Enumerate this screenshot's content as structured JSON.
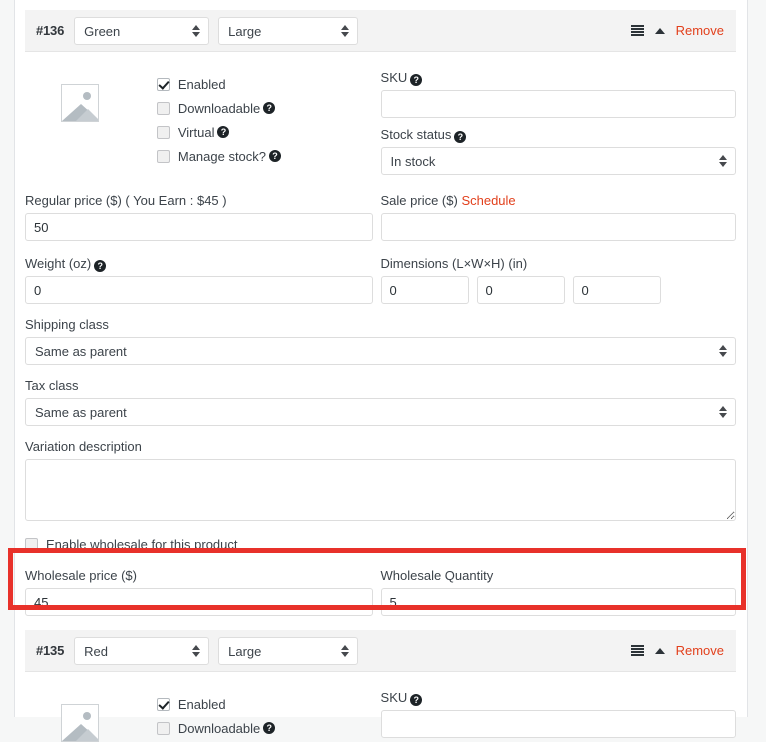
{
  "variations": [
    {
      "id": "#136",
      "attribute_color": "Green",
      "attribute_size": "Large",
      "remove_label": "Remove",
      "checkboxes": [
        {
          "label": "Enabled",
          "checked": true,
          "help": false
        },
        {
          "label": "Downloadable",
          "checked": false,
          "help": true
        },
        {
          "label": "Virtual",
          "checked": false,
          "help": true
        },
        {
          "label": "Manage stock?",
          "checked": false,
          "help": true
        }
      ],
      "sku_label": "SKU",
      "sku_value": "",
      "stock_status_label": "Stock status",
      "stock_status_value": "In stock",
      "regular_price_label": "Regular price ($) ( You Earn : $45 )",
      "regular_price_value": "50",
      "sale_price_label": "Sale price ($)",
      "sale_price_schedule": "Schedule",
      "sale_price_value": "",
      "weight_label": "Weight (oz)",
      "weight_value": "0",
      "dimensions_label": "Dimensions (L×W×H) (in)",
      "dimension_length": "0",
      "dimension_width": "0",
      "dimension_height": "0",
      "shipping_class_label": "Shipping class",
      "shipping_class_value": "Same as parent",
      "tax_class_label": "Tax class",
      "tax_class_value": "Same as parent",
      "variation_description_label": "Variation description",
      "variation_description_value": "",
      "enable_wholesale_label": "Enable wholesale for this product",
      "enable_wholesale_checked": false,
      "wholesale_price_label": "Wholesale price ($)",
      "wholesale_price_value": "45",
      "wholesale_quantity_label": "Wholesale Quantity",
      "wholesale_quantity_value": "5"
    },
    {
      "id": "#135",
      "attribute_color": "Red",
      "attribute_size": "Large",
      "remove_label": "Remove",
      "checkboxes": [
        {
          "label": "Enabled",
          "checked": true,
          "help": false
        },
        {
          "label": "Downloadable",
          "checked": false,
          "help": true
        }
      ],
      "sku_label": "SKU",
      "sku_value": ""
    }
  ],
  "colors": {
    "accent_remove": "#e2401c",
    "highlight": "#e8312a",
    "header_bg": "#f3f3f3",
    "border": "#dddddd"
  }
}
